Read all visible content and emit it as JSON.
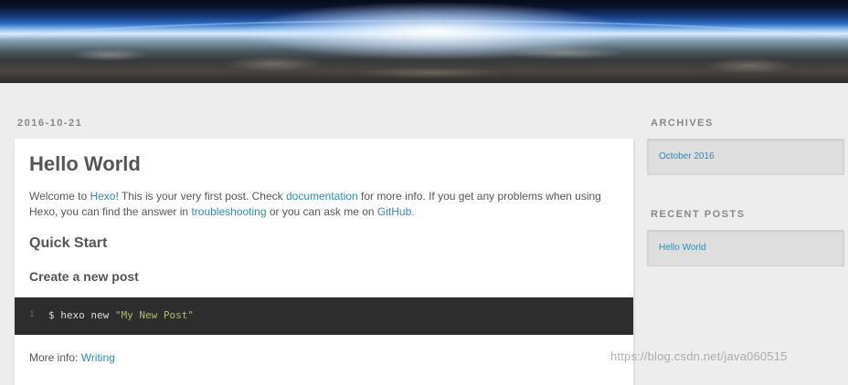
{
  "post": {
    "date": "2016-10-21",
    "title": "Hello World",
    "intro": {
      "t1": "Welcome to ",
      "hexo_link": "Hexo",
      "t2": "! This is your very first post. Check ",
      "docs_link": "documentation",
      "t3": " for more info. If you get any problems when using Hexo, you can find the answer in ",
      "troubleshooting_link": "troubleshooting",
      "t4": " or you can ask me on ",
      "github_link": "GitHub",
      "t5": "."
    },
    "quick_start_heading": "Quick Start",
    "create_post_heading": "Create a new post",
    "code": {
      "line_number": "1",
      "command": "$ hexo new ",
      "argument": "\"My New Post\""
    },
    "more_info": {
      "label": "More info: ",
      "link": "Writing"
    }
  },
  "sidebar": {
    "archives": {
      "title": "ARCHIVES",
      "items": [
        "October 2016"
      ]
    },
    "recent_posts": {
      "title": "RECENT POSTS",
      "items": [
        "Hello World"
      ]
    }
  },
  "watermark": "https://blog.csdn.net/java060515",
  "colors": {
    "link": "#258fb8",
    "page_background": "#ededed",
    "code_background": "#2d2d2d"
  }
}
